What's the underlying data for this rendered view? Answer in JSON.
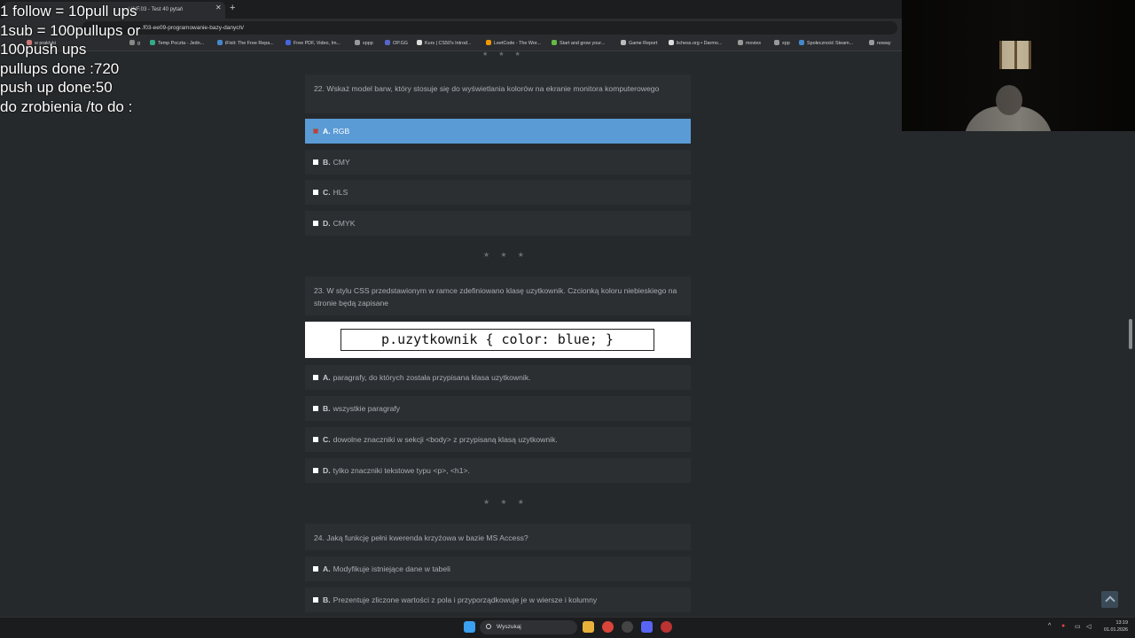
{
  "browser": {
    "tab_title": "... / INF.03 - Test 40 pytań",
    "url": "...f03-ee09-programowanie-bazy-danych/",
    "bookmarks": [
      {
        "label": "w praktyki",
        "color": "#c77"
      },
      {
        "label": "g",
        "color": "#888"
      },
      {
        "label": "Temp Poczta - Jedn...",
        "color": "#3a8"
      },
      {
        "label": "iFixit: The Free Repa...",
        "color": "#48c"
      },
      {
        "label": "Free PDF, Video, Im...",
        "color": "#46d"
      },
      {
        "label": "xppp",
        "color": "#999"
      },
      {
        "label": "OP.GG",
        "color": "#56c"
      },
      {
        "label": "Kurs | CS50's Introd...",
        "color": "#ddd"
      },
      {
        "label": "LeetCode - The Wor...",
        "color": "#e90"
      },
      {
        "label": "Start and grow your...",
        "color": "#6b4"
      },
      {
        "label": "Game Report",
        "color": "#bbb"
      },
      {
        "label": "lichess.org • Darmo...",
        "color": "#ddd"
      },
      {
        "label": "movies",
        "color": "#999"
      },
      {
        "label": "xpp",
        "color": "#999"
      },
      {
        "label": "Społeczność Steam...",
        "color": "#48c"
      },
      {
        "label": "noway",
        "color": "#999"
      }
    ]
  },
  "overlay": {
    "lines": [
      "1 follow = 10pull ups",
      "1sub = 100pullups or",
      "100push ups",
      "pullups done :720",
      "push up done:50",
      "do zrobienia /to do :"
    ]
  },
  "quiz": {
    "q22": {
      "text": "22. Wskaż model barw, który stosuje się do wyświetlania kolorów na ekranie monitora komputerowego",
      "answers": [
        {
          "letter": "A.",
          "text": "RGB",
          "selected": true
        },
        {
          "letter": "B.",
          "text": "CMY",
          "selected": false
        },
        {
          "letter": "C.",
          "text": "HLS",
          "selected": false
        },
        {
          "letter": "D.",
          "text": "CMYK",
          "selected": false
        }
      ]
    },
    "q23": {
      "text": "23. W stylu CSS przedstawionym w ramce zdefiniowano klasę uzytkownik. Czcionką koloru niebieskiego na stronie będą zapisane",
      "code": "p.uzytkownik { color: blue; }",
      "answers": [
        {
          "letter": "A.",
          "text": "paragrafy, do których została przypisana klasa uzytkownik."
        },
        {
          "letter": "B.",
          "text": "wszystkie paragrafy"
        },
        {
          "letter": "C.",
          "text": "dowolne znaczniki w sekcji <body> z przypisaną klasą uzytkownik."
        },
        {
          "letter": "D.",
          "text": "tylko znaczniki tekstowe typu <p>, <h1>."
        }
      ]
    },
    "q24": {
      "text": "24. Jaką funkcję pełni kwerenda krzyżowa w bazie MS Access?",
      "answers": [
        {
          "letter": "A.",
          "text": "Modyfikuje istniejące dane w tabeli"
        },
        {
          "letter": "B.",
          "text": "Prezentuje zliczone wartości z pola i przyporządkowuje je w wiersze i kolumny"
        }
      ]
    },
    "separator": "★ ★ ★"
  },
  "taskbar": {
    "search_placeholder": "Wyszukaj",
    "time": "13:19",
    "date": "01.01.2026"
  }
}
